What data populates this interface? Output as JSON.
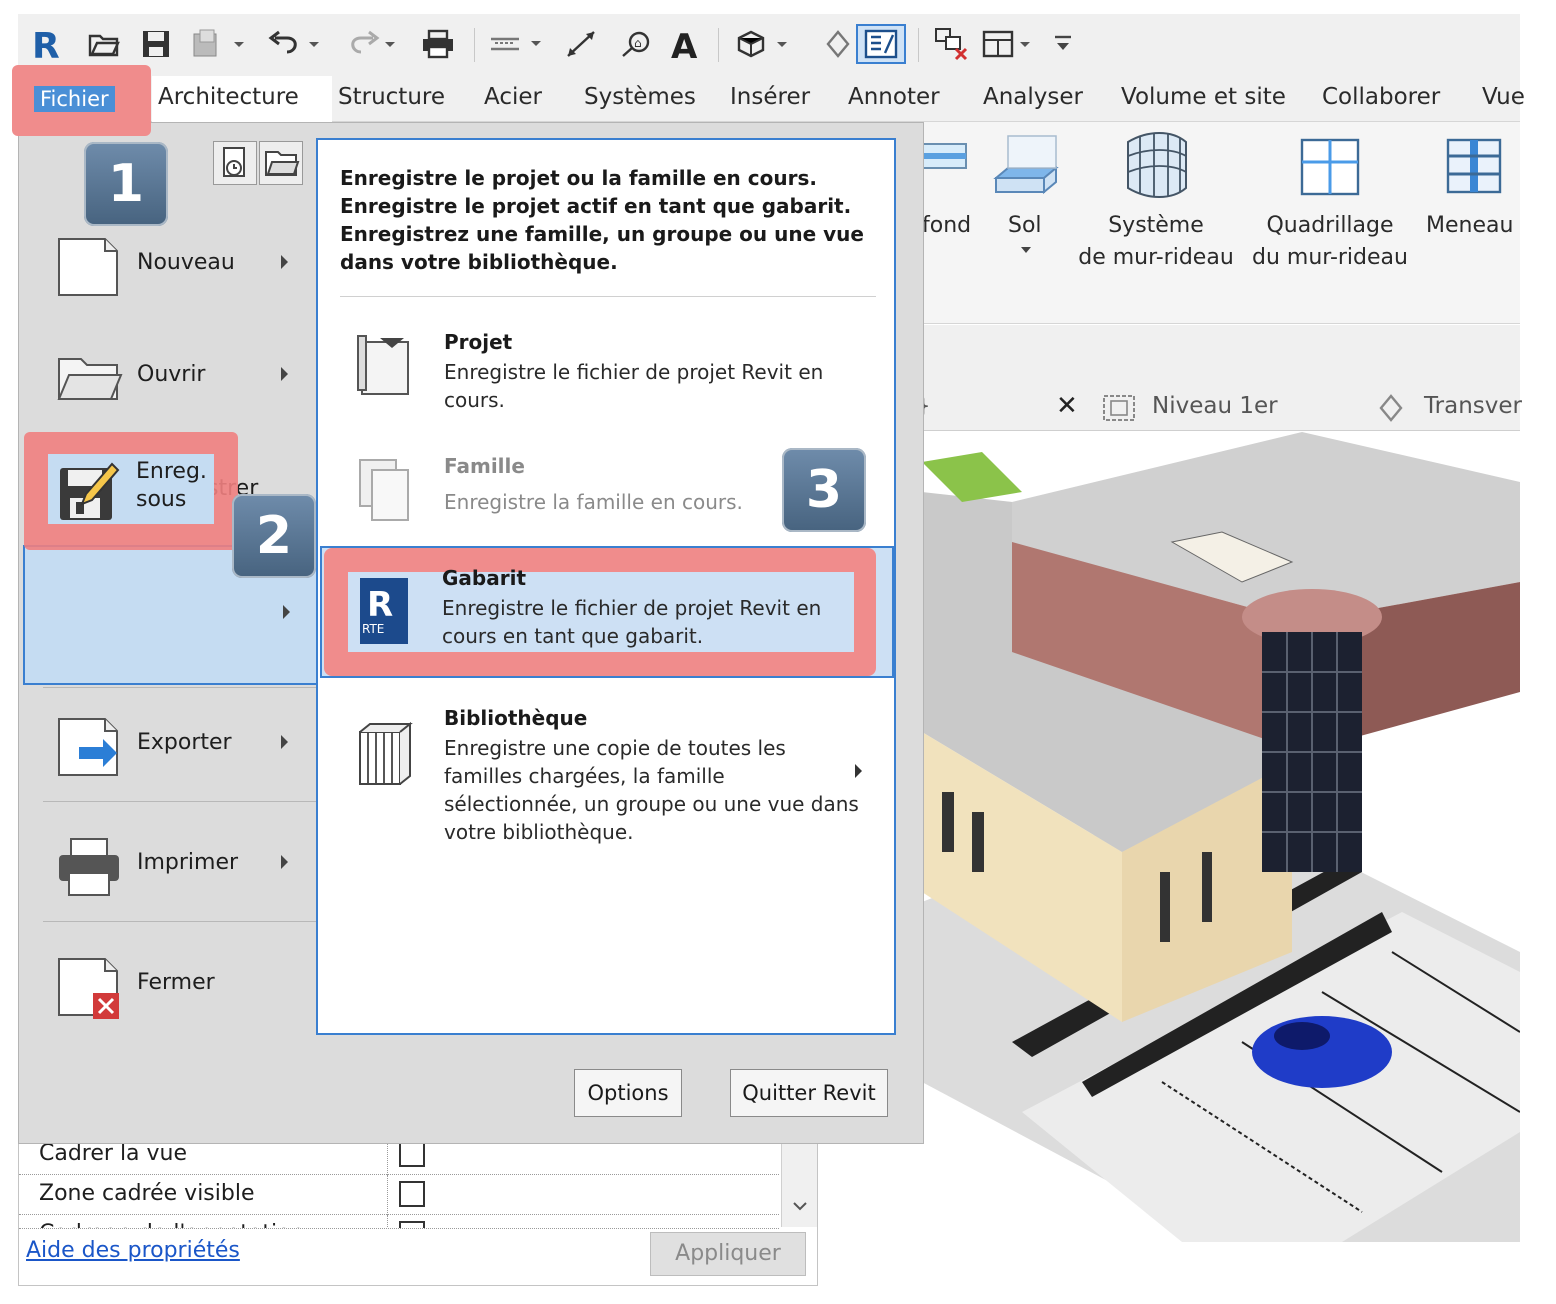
{
  "tabs": {
    "fichier": "Fichier",
    "items": [
      "Architecture",
      "Structure",
      "Acier",
      "Systèmes",
      "Insérer",
      "Annoter",
      "Analyser",
      "Volume et site",
      "Collaborer",
      "Vue"
    ]
  },
  "ribbon": {
    "fond": "fond",
    "sol": "Sol",
    "systeme_1": "Système",
    "systeme_2": "de mur-rideau",
    "quadrillage_1": "Quadrillage",
    "quadrillage_2": "du mur-rideau",
    "meneau": "Meneau"
  },
  "view_tabs": {
    "brace": "}",
    "close": "✕",
    "niveau": "Niveau 1er",
    "transver": "Transver"
  },
  "app_menu": {
    "items": [
      {
        "label": "Nouveau"
      },
      {
        "label": "Ouvrir"
      },
      {
        "label": "Enregistrer"
      },
      {
        "label_1": "Enreg.",
        "label_2": "sous"
      },
      {
        "label": "Exporter"
      },
      {
        "label": "Imprimer"
      },
      {
        "label": "Fermer"
      }
    ],
    "submenu": {
      "header": "Enregistre le projet ou la famille en cours. Enregistre le projet actif en tant que gabarit. Enregistrez une famille, un groupe ou une vue dans votre bibliothèque.",
      "options": [
        {
          "title": "Projet",
          "desc": "Enregistre le fichier de projet Revit en cours."
        },
        {
          "title": "Famille",
          "desc": "Enregistre la famille en cours."
        },
        {
          "title": "Gabarit",
          "desc": "Enregistre le fichier de projet Revit en cours en tant que gabarit.",
          "icon_text": "RTE"
        },
        {
          "title": "Bibliothèque",
          "desc": "Enregistre une copie de toutes les familles chargées, la famille sélectionnée, un groupe ou une vue dans votre bibliothèque."
        }
      ]
    },
    "options_button": "Options",
    "quit_button": "Quitter Revit"
  },
  "badges": [
    "1",
    "2",
    "3"
  ],
  "properties": {
    "rows": [
      "Cadrer la vue",
      "Zone cadrée visible",
      "Cadrage de l'annotation"
    ],
    "help_link": "Aide des propriétés",
    "apply_button": "Appliquer"
  },
  "colors": {
    "highlight": "#f08c8c",
    "selection_blue": "#c5dcf2",
    "accent_blue": "#3a7fd0",
    "badge": "#5a7898"
  }
}
